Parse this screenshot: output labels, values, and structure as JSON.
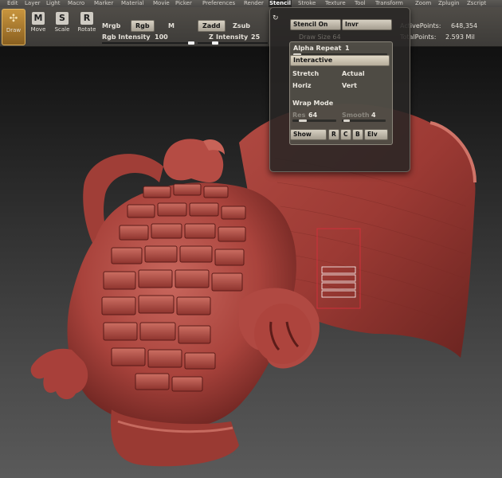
{
  "menu": [
    "Edit",
    "Layer",
    "Light",
    "Macro",
    "Marker",
    "Material",
    "Movie",
    "Picker",
    "Preferences",
    "Render",
    "Stencil",
    "Stroke",
    "Texture",
    "Tool",
    "Transform",
    "Zoom",
    "Zplugin",
    "Zscript"
  ],
  "menu_active": "Stencil",
  "tools": [
    {
      "label": "Draw",
      "icon": "✣"
    },
    {
      "label": "Move",
      "icon": "M"
    },
    {
      "label": "Scale",
      "icon": "S"
    },
    {
      "label": "Rotate",
      "icon": "R"
    }
  ],
  "toolbar": {
    "mrgb": "Mrgb",
    "rgb_btn": "Rgb",
    "m_label": "M",
    "rgb_intensity_label": "Rgb Intensity",
    "rgb_intensity": "100",
    "zadd_btn": "Zadd",
    "zsub": "Zsub",
    "z_label": "Z",
    "z_intensity_label": "Intensity",
    "z_intensity": "25",
    "active_points_label": "ActivePoints:",
    "active_points": "648,354",
    "total_points_label": "TotalPoints:",
    "total_points": "2.593 Mil",
    "draw_size_ghost": "Draw Size 64",
    "z_intensity_fraction": 0.25,
    "rgb_intensity_fraction": 1.0
  },
  "stencil": {
    "stencil_on": "Stencil On",
    "invr": "Invr",
    "alpha_repeat_label": "Alpha Repeat",
    "alpha_repeat": "1",
    "interactive": "Interactive",
    "stretch": "Stretch",
    "actual": "Actual",
    "horiz": "Horiz",
    "vert": "Vert",
    "wrap_mode": "Wrap Mode",
    "res_label": "Res",
    "res": "64",
    "smooth_label": "Smooth",
    "smooth": "4",
    "show": "Show",
    "r": "R",
    "c": "C",
    "b": "B",
    "elv": "Elv"
  },
  "colors": {
    "clay": "#a9433c",
    "clay_light": "#c8675d",
    "clay_dark": "#5c1c19",
    "accent_draw": "#c8953e",
    "selection_box": "#d0303a"
  }
}
